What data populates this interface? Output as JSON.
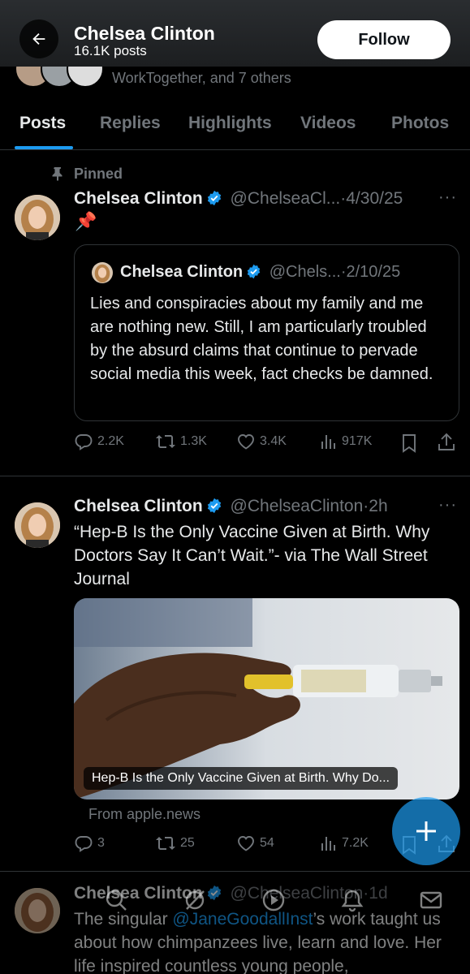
{
  "header": {
    "name": "Chelsea Clinton",
    "posts_count": "16.1K posts",
    "follow_label": "Follow"
  },
  "followers_peek": {
    "text": "WorkTogether, and 7 others"
  },
  "tabs": [
    {
      "label": "Posts",
      "active": true
    },
    {
      "label": "Replies"
    },
    {
      "label": "Highlights"
    },
    {
      "label": "Videos"
    },
    {
      "label": "Photos"
    }
  ],
  "posts": [
    {
      "pinned_label": "Pinned",
      "author": "Chelsea Clinton",
      "handle": "@ChelseaCl...",
      "date": "4/30/25",
      "body": "📌",
      "quote": {
        "author": "Chelsea Clinton",
        "handle": "@Chels...",
        "date": "2/10/25",
        "text": "Lies and conspiracies about my family and me are nothing new. Still, I am particularly troubled by the absurd claims that continue to pervade social media this week, fact checks be damned."
      },
      "stats": {
        "replies": "2.2K",
        "reposts": "1.3K",
        "likes": "3.4K",
        "views": "917K"
      }
    },
    {
      "author": "Chelsea Clinton",
      "handle": "@ChelseaClinton",
      "date": "2h",
      "body": "“Hep-B Is the Only Vaccine Given at Birth. Why Doctors Say It Can’t Wait.”- via The Wall Street Journal",
      "card_title": "Hep-B Is the Only Vaccine Given at Birth. Why Do...",
      "card_source": "From apple.news",
      "stats": {
        "replies": "3",
        "reposts": "25",
        "likes": "54",
        "views": "7.2K"
      }
    },
    {
      "author": "Chelsea Clinton",
      "handle": "@ChelseaClinton",
      "date": "1d",
      "text_before": "The singular ",
      "mention": "@JaneGoodallInst",
      "text_after": "’s work taught us about how chimpanzees live, learn and love. Her life inspired countless young people,"
    }
  ],
  "colors": {
    "accent": "#1d9bf0",
    "muted": "#71767b",
    "verified": "#1d9bf0"
  }
}
